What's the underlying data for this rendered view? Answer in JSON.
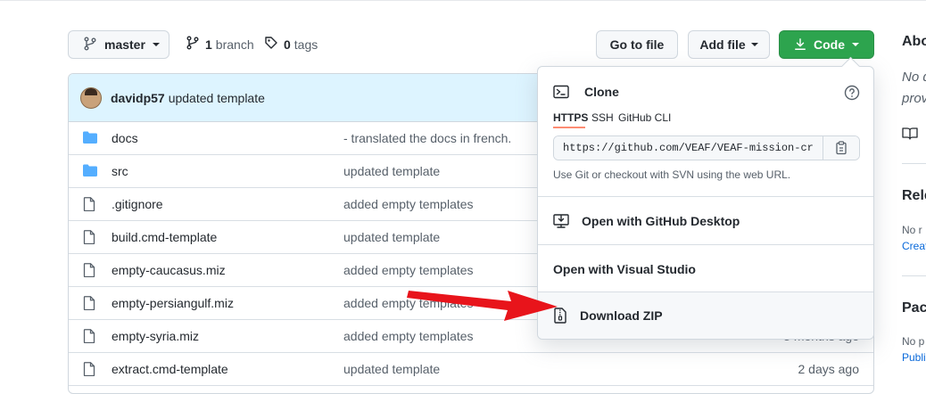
{
  "repo_bar": {
    "branch_label": "master",
    "branches_count": "1",
    "branches_label": "branch",
    "tags_count": "0",
    "tags_label": "tags",
    "goto_file": "Go to file",
    "add_file": "Add file",
    "code": "Code"
  },
  "latest_commit": {
    "author": "davidp57",
    "message": "updated template"
  },
  "files": [
    {
      "icon": "folder-icon",
      "name": "docs",
      "message": "- translated the docs in french.",
      "age": ""
    },
    {
      "icon": "folder-icon",
      "name": "src",
      "message": "updated template",
      "age": ""
    },
    {
      "icon": "file-icon",
      "name": ".gitignore",
      "message": "added empty templates",
      "age": ""
    },
    {
      "icon": "file-icon",
      "name": "build.cmd-template",
      "message": "updated template",
      "age": ""
    },
    {
      "icon": "file-icon",
      "name": "empty-caucasus.miz",
      "message": "added empty templates",
      "age": ""
    },
    {
      "icon": "file-icon",
      "name": "empty-persiangulf.miz",
      "message": "added empty templates",
      "age": ""
    },
    {
      "icon": "file-icon",
      "name": "empty-syria.miz",
      "message": "added empty templates",
      "age": "3 months ago"
    },
    {
      "icon": "file-icon",
      "name": "extract.cmd-template",
      "message": "updated template",
      "age": "2 days ago"
    }
  ],
  "code_dropdown": {
    "clone_title": "Clone",
    "tabs": [
      "HTTPS",
      "SSH",
      "GitHub CLI"
    ],
    "active_tab": "HTTPS",
    "clone_url": "https://github.com/VEAF/VEAF-mission-creation-tools.git",
    "hint": "Use Git or checkout with SVN using the web URL.",
    "open_desktop": "Open with GitHub Desktop",
    "open_vs": "Open with Visual Studio",
    "download_zip": "Download ZIP"
  },
  "sidebar": {
    "about_heading": "Abo",
    "about_text_1": "No d",
    "about_text_2": "prov",
    "releases_heading": "Rele",
    "releases_text": "No r",
    "releases_link": "Creat",
    "packages_heading": "Pack",
    "packages_text": "No p",
    "packages_link": "Publi"
  },
  "colors": {
    "code_button": "#2da44e",
    "commit_row": "#ddf4ff",
    "folder": "#54aeff",
    "link": "#0969da",
    "annotation_arrow": "#e8141b"
  }
}
